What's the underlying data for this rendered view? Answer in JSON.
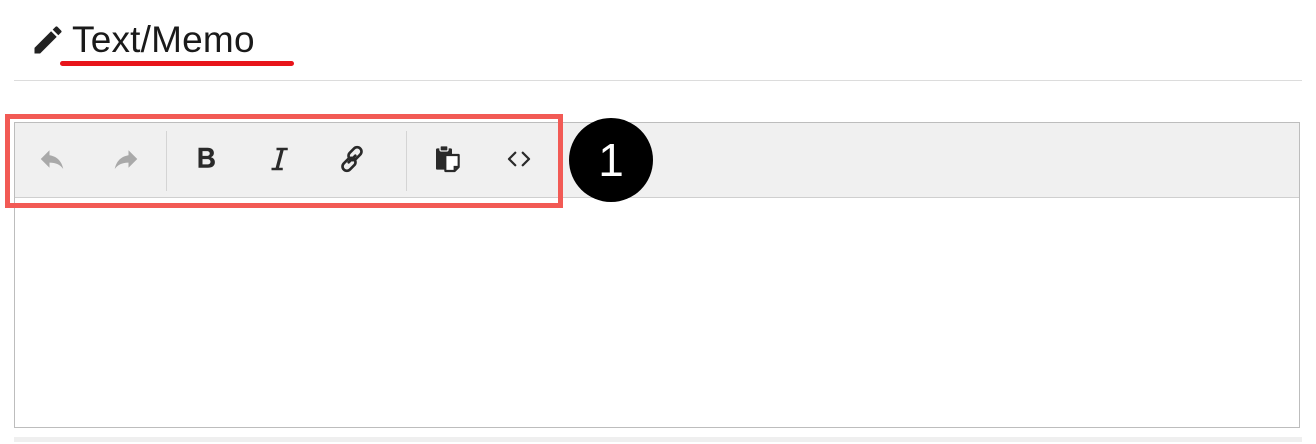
{
  "header": {
    "title": "Text/Memo",
    "icon": "pencil-icon",
    "underline_color": "#e8141a"
  },
  "toolbar": {
    "buttons": [
      {
        "id": "undo",
        "icon": "undo-icon",
        "enabled": false
      },
      {
        "id": "redo",
        "icon": "redo-icon",
        "enabled": false
      },
      {
        "id": "bold",
        "icon": "bold-icon",
        "enabled": true
      },
      {
        "id": "italic",
        "icon": "italic-icon",
        "enabled": true
      },
      {
        "id": "link",
        "icon": "link-icon",
        "enabled": true
      },
      {
        "id": "paste",
        "icon": "paste-icon",
        "enabled": true
      },
      {
        "id": "source",
        "icon": "code-icon",
        "enabled": true
      }
    ]
  },
  "editor": {
    "content": ""
  },
  "annotation": {
    "callout_number": "1",
    "highlight_color": "#f25a55"
  }
}
